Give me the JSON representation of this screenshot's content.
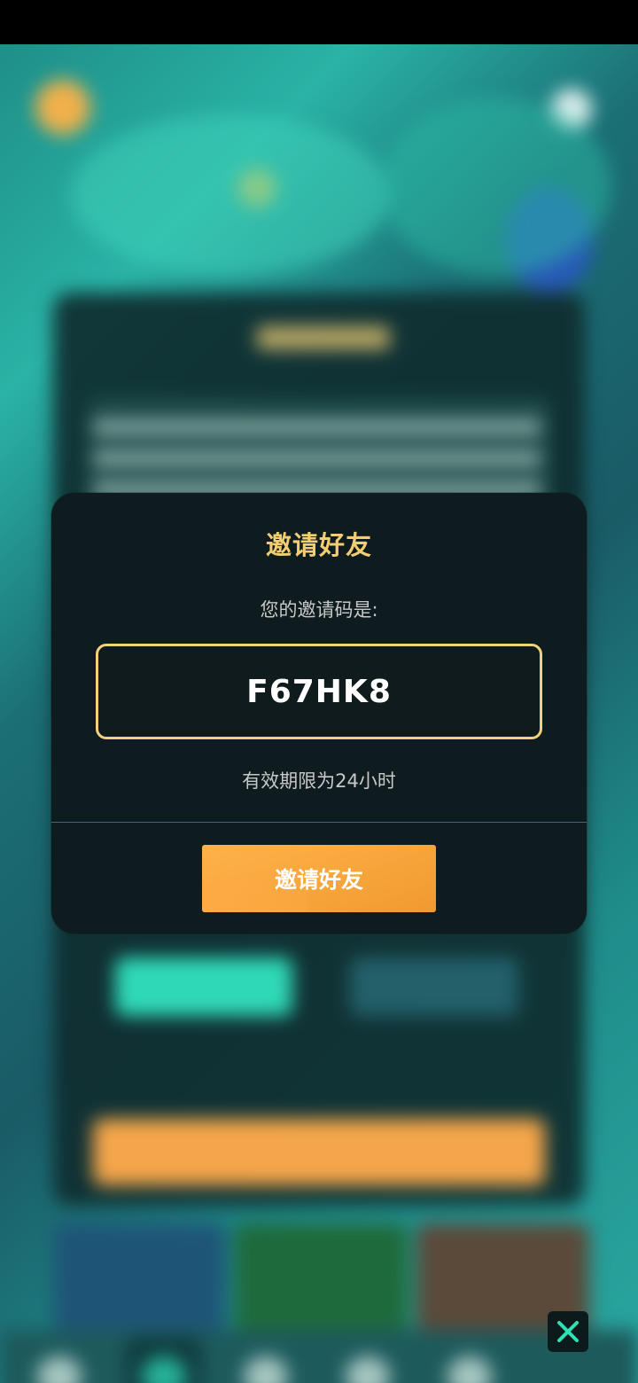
{
  "modal": {
    "title": "邀请好友",
    "code_label": "您的邀请码是:",
    "invite_code": "F67HK8",
    "validity_text": "有效期限为24小时",
    "invite_button_label": "邀请好友"
  },
  "icons": {
    "close": "close-icon"
  },
  "colors": {
    "title_gold": "#f2cd72",
    "code_border": "#f0d27c",
    "button_orange": "#f6a43a",
    "modal_bg": "#0f1c1f",
    "close_x": "#2fe0b5"
  }
}
